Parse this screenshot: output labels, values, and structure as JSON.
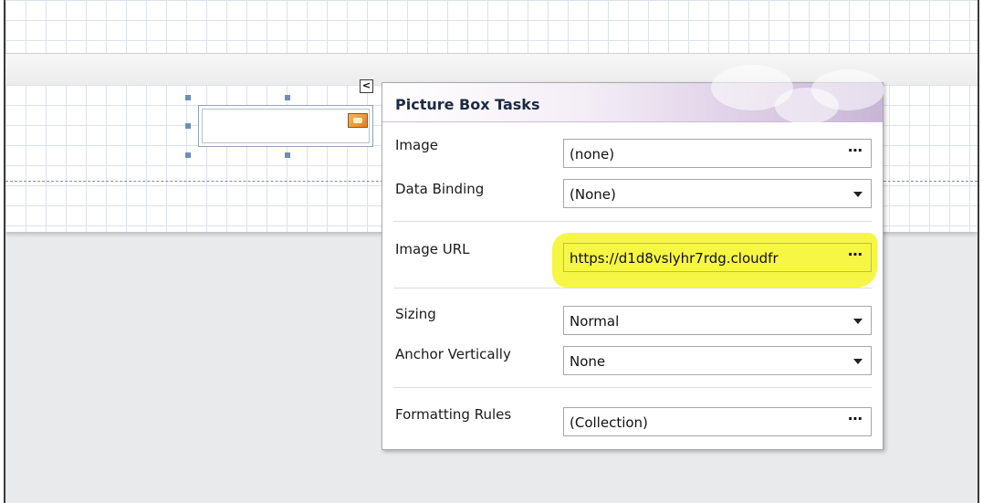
{
  "panel": {
    "title": "Picture Box Tasks",
    "rows": {
      "image": {
        "label": "Image",
        "value": "(none)",
        "button": "⋯"
      },
      "data_binding": {
        "label": "Data Binding",
        "value": "(None)"
      },
      "image_url": {
        "label": "Image URL",
        "value": "https://d1d8vslyhr7rdg.cloudfr",
        "button": "⋯"
      },
      "sizing": {
        "label": "Sizing",
        "value": "Normal"
      },
      "anchor_vertically": {
        "label": "Anchor Vertically",
        "value": "None"
      },
      "formatting_rules": {
        "label": "Formatting Rules",
        "value": "(Collection)",
        "button": "⋯"
      }
    }
  },
  "smart_tag": {
    "glyph": "<"
  },
  "colors": {
    "highlight": "#f6f53a",
    "handle": "#6f8fb4",
    "title": "#1c2a44"
  },
  "icons": [
    "smart-tag-icon",
    "picture-icon",
    "ellipsis-icon",
    "chevron-down-icon"
  ]
}
